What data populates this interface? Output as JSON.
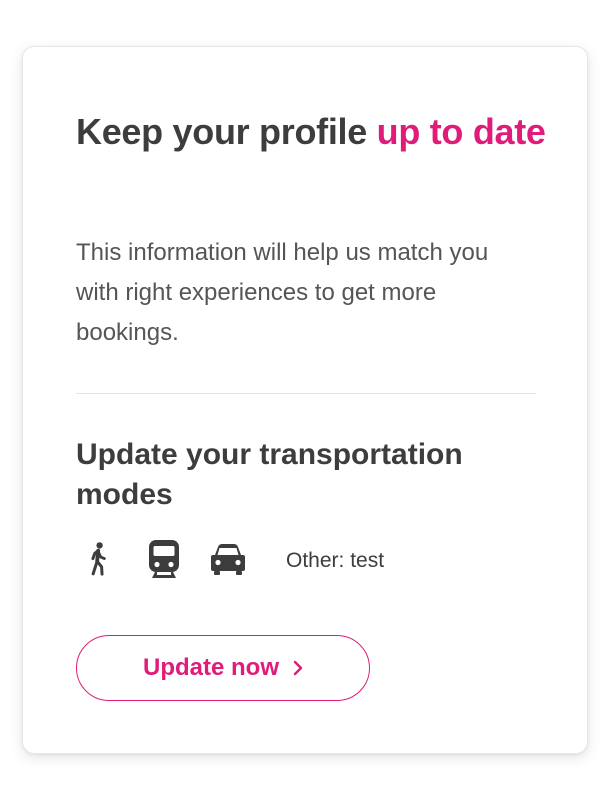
{
  "card": {
    "title_main": "Keep your profile ",
    "title_accent": "up to date",
    "description": "This information will help us match you with right experiences to get more bookings.",
    "section_title": "Update your transportation modes",
    "modes": [
      {
        "icon": "walking-icon"
      },
      {
        "icon": "train-icon"
      },
      {
        "icon": "car-icon"
      }
    ],
    "other_mode": "Other: test",
    "button_label": "Update now"
  },
  "colors": {
    "accent": "#e01b79",
    "heading": "#3d3d3d",
    "body_text": "#555555",
    "divider": "#e3e3e3"
  }
}
